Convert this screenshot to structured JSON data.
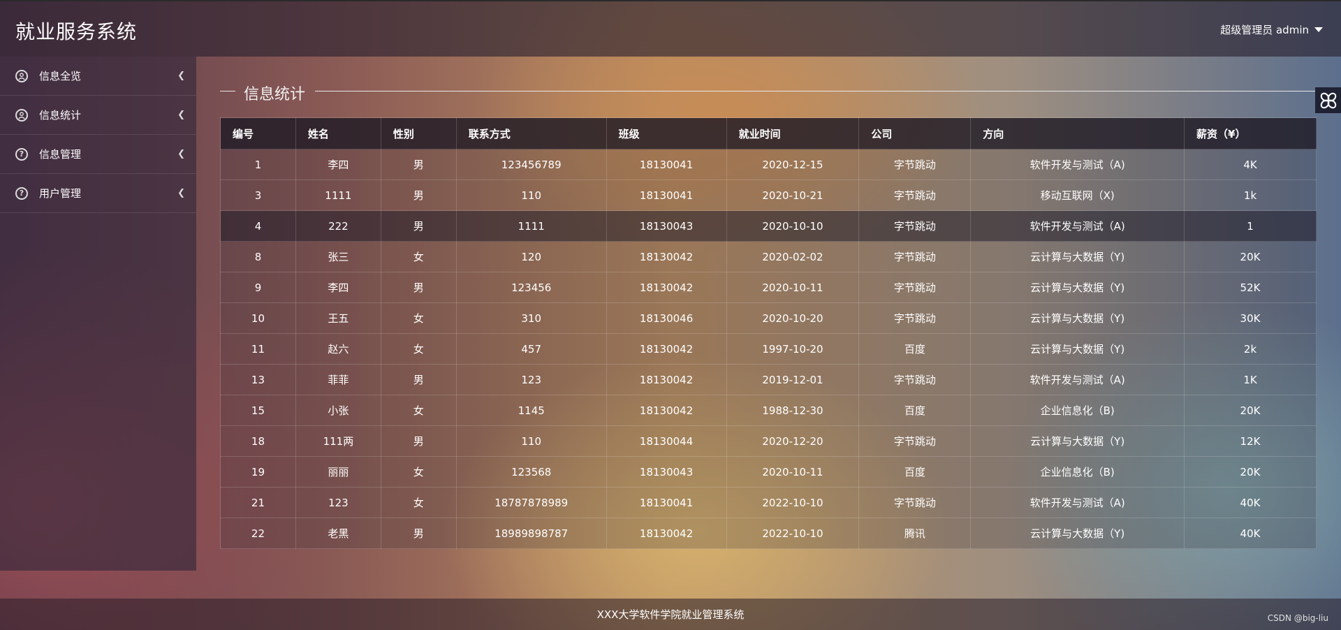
{
  "header": {
    "title": "就业服务系统",
    "user_label": "超级管理员 admin"
  },
  "sidebar": {
    "items": [
      {
        "label": "信息全览",
        "icon": "user-circle-icon"
      },
      {
        "label": "信息统计",
        "icon": "user-circle-icon"
      },
      {
        "label": "信息管理",
        "icon": "question-circle-icon"
      },
      {
        "label": "用户管理",
        "icon": "question-circle-icon"
      }
    ]
  },
  "section": {
    "title": "信息统计"
  },
  "table": {
    "columns": [
      "编号",
      "姓名",
      "性别",
      "联系方式",
      "班级",
      "就业时间",
      "公司",
      "方向",
      "薪资（¥）"
    ],
    "rows": [
      [
        "1",
        "李四",
        "男",
        "123456789",
        "18130041",
        "2020-12-15",
        "字节跳动",
        "软件开发与测试（A)",
        "4K"
      ],
      [
        "3",
        "1111",
        "男",
        "110",
        "18130041",
        "2020-10-21",
        "字节跳动",
        "移动互联网（X)",
        "1k"
      ],
      [
        "4",
        "222",
        "男",
        "1111",
        "18130043",
        "2020-10-10",
        "字节跳动",
        "软件开发与测试（A)",
        "1"
      ],
      [
        "8",
        "张三",
        "女",
        "120",
        "18130042",
        "2020-02-02",
        "字节跳动",
        "云计算与大数据（Y)",
        "20K"
      ],
      [
        "9",
        "李四",
        "男",
        "123456",
        "18130042",
        "2020-10-11",
        "字节跳动",
        "云计算与大数据（Y)",
        "52K"
      ],
      [
        "10",
        "王五",
        "女",
        "310",
        "18130046",
        "2020-10-20",
        "字节跳动",
        "云计算与大数据（Y)",
        "30K"
      ],
      [
        "11",
        "赵六",
        "女",
        "457",
        "18130042",
        "1997-10-20",
        "百度",
        "云计算与大数据（Y)",
        "2k"
      ],
      [
        "13",
        "菲菲",
        "男",
        "123",
        "18130042",
        "2019-12-01",
        "字节跳动",
        "软件开发与测试（A)",
        "1K"
      ],
      [
        "15",
        "小张",
        "女",
        "1145",
        "18130042",
        "1988-12-30",
        "百度",
        "企业信息化（B)",
        "20K"
      ],
      [
        "18",
        "111两",
        "男",
        "110",
        "18130044",
        "2020-12-20",
        "字节跳动",
        "云计算与大数据（Y)",
        "12K"
      ],
      [
        "19",
        "丽丽",
        "女",
        "123568",
        "18130043",
        "2020-10-11",
        "百度",
        "企业信息化（B)",
        "20K"
      ],
      [
        "21",
        "123",
        "女",
        "18787878989",
        "18130041",
        "2022-10-10",
        "字节跳动",
        "软件开发与测试（A)",
        "40K"
      ],
      [
        "22",
        "老黑",
        "男",
        "18989898787",
        "18130042",
        "2022-10-10",
        "腾讯",
        "云计算与大数据（Y)",
        "40K"
      ]
    ],
    "highlighted_row": 2
  },
  "footer": {
    "text": "XXX大学软件学院就业管理系统"
  },
  "watermark": "CSDN @big-liu",
  "float_button_icon": "flower-icon"
}
